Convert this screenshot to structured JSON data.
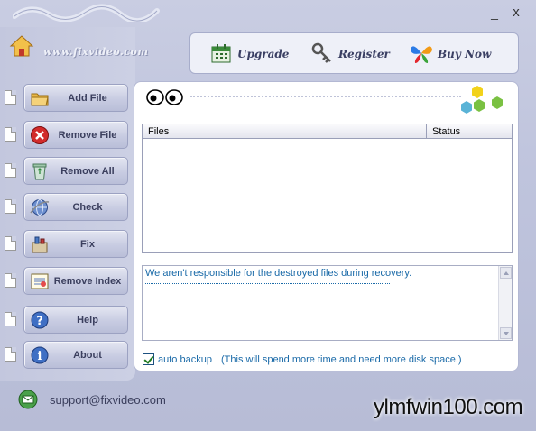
{
  "window": {
    "minimize_glyph": "_",
    "close_glyph": "x"
  },
  "sidebar": {
    "home_icon": "house-icon",
    "site_link": "www.fixvideo.com",
    "items": [
      {
        "label": "Add File",
        "icon": "folder-icon"
      },
      {
        "label": "Remove File",
        "icon": "red-x-icon"
      },
      {
        "label": "Remove All",
        "icon": "recycle-bin-icon"
      },
      {
        "label": "Check",
        "icon": "globe-icon"
      },
      {
        "label": "Fix",
        "icon": "tools-icon"
      },
      {
        "label": "Remove Index",
        "icon": "index-icon"
      },
      {
        "label": "Help",
        "icon": "question-icon"
      },
      {
        "label": "About",
        "icon": "info-icon"
      }
    ]
  },
  "toolbar": {
    "upgrade_label": "Upgrade",
    "register_label": "Register",
    "buynow_label": "Buy Now"
  },
  "file_table": {
    "columns": [
      "Files",
      "Status"
    ],
    "rows": []
  },
  "log": {
    "message": "We aren't responsible for the destroyed files during recovery."
  },
  "backup": {
    "checked": true,
    "label": "auto backup",
    "note": "(This will spend more time and need more disk space.)"
  },
  "footer": {
    "support_email": "support@fixvideo.com",
    "watermark": "ylmfwin100.com"
  },
  "colors": {
    "accent_text": "#1a6aa8",
    "panel_bg": "#c3c7de",
    "button_text": "#3b3f5e"
  }
}
